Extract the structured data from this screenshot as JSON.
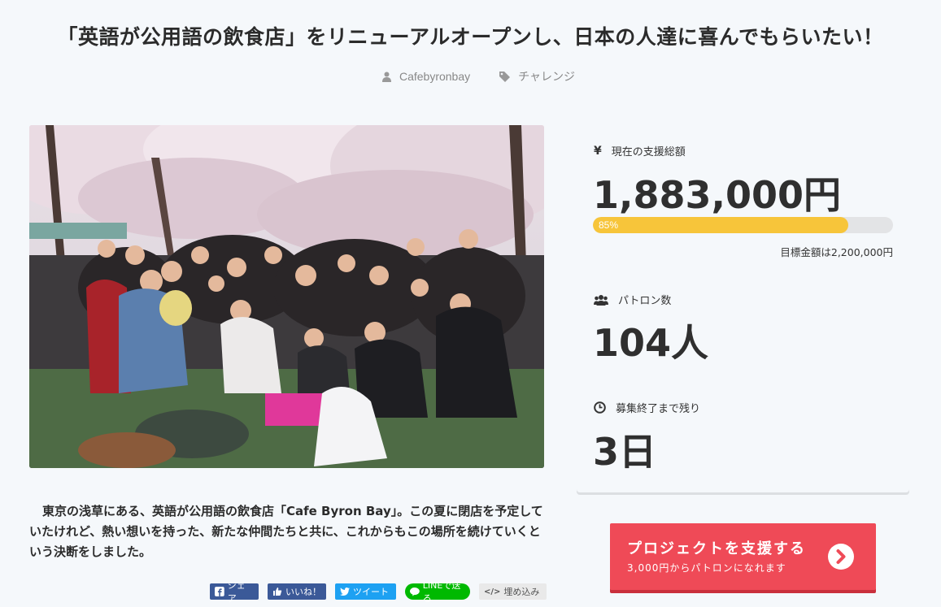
{
  "page": {
    "title": "「英語が公用語の飲食店」をリニューアルオープンし、日本の人達に喜んでもらいたい！",
    "author": "Cafebyronbay",
    "category": "チャレンジ"
  },
  "description": "東京の浅草にある、英語が公用語の飲食店「Cafe Byron Bay」。この夏に閉店を予定していたけれど、熱い想いを持った、新たな仲間たちと共に、これからもこの場所を続けていくという決断をしました。",
  "share": {
    "facebook": "シェア",
    "like": "いいね！",
    "twitter": "ツイート",
    "line": "LINEで送る",
    "embed": "埋め込み"
  },
  "stats": {
    "amount_label": "現在の支援総額",
    "amount": "1,883,000円",
    "progress_label": "85%",
    "progress_fraction": 0.85,
    "goal": "目標金額は2,200,000円",
    "patrons_label": "パトロン数",
    "patrons": "104人",
    "remaining_label": "募集終了まで残り",
    "remaining": "3日"
  },
  "cta": {
    "label": "プロジェクトを支援する",
    "sub": "3,000円からパトロンになれます"
  },
  "colors": {
    "accent": "#ef4a57",
    "progress": "#f7c53a",
    "facebook": "#3b5998",
    "twitter": "#1da1f2",
    "line": "#00b900"
  }
}
